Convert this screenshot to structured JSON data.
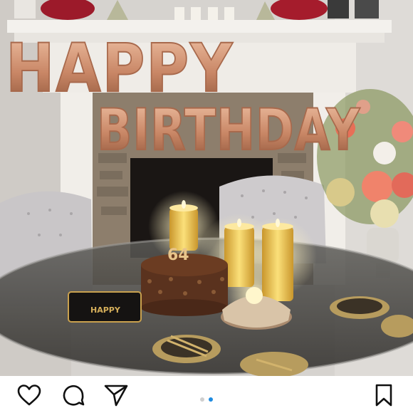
{
  "post": {
    "photo": {
      "balloon_text_line1": "HAPPY",
      "balloon_text_line2": "BIRTHDAY",
      "candle_number": "64",
      "cake_box_text": "HAPPY",
      "colors": {
        "wall": "#d9d6d2",
        "mantel": "#f2f0ec",
        "balloon": "#c98766",
        "balloon_shine": "#f0c3a6",
        "fireplace": "#1a1614",
        "chair": "#c9c6c8",
        "candle": "#f2c84f",
        "flower_pink": "#f0836b",
        "cake": "#5a321e",
        "gold_plate": "#b79c5e"
      }
    },
    "actions": {
      "icons": [
        "heart-icon",
        "comment-icon",
        "share-icon",
        "bookmark-icon"
      ]
    },
    "carousel": {
      "count": 2,
      "active_index": 1
    }
  }
}
